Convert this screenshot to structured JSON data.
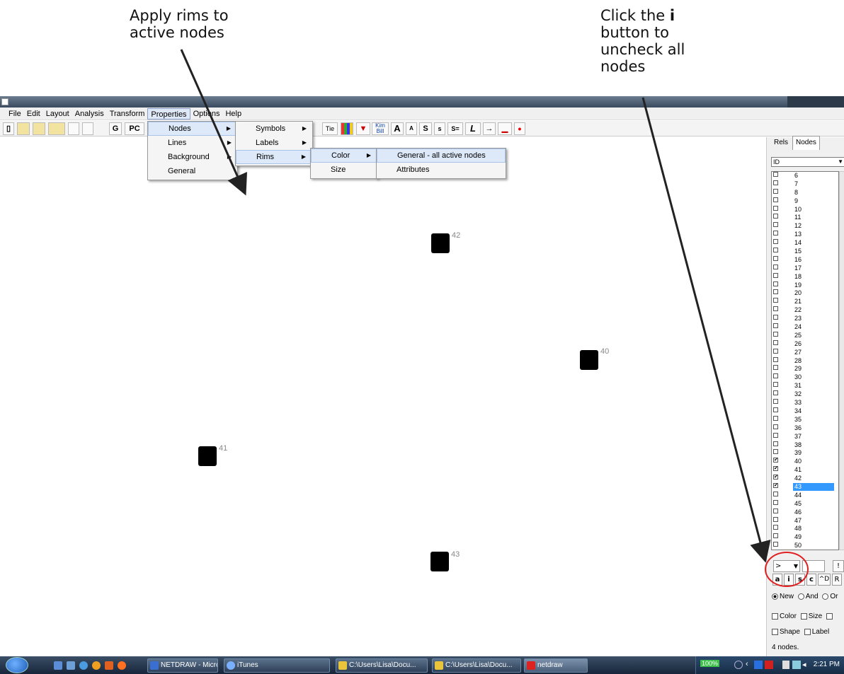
{
  "annotations": {
    "left_line1": "Apply rims to",
    "left_line2": "active nodes",
    "right_line1": "Click the ",
    "right_bold": "i",
    "right_line2": "button to",
    "right_line3": "uncheck all",
    "right_line4": "nodes"
  },
  "menubar": [
    "File",
    "Edit",
    "Layout",
    "Analysis",
    "Transform",
    "Properties",
    "Options",
    "Help"
  ],
  "toolbar": {
    "g": "G",
    "pc": "PC",
    "tie": "Tie",
    "kim_bill": "Kim Bill",
    "a_big": "A",
    "a_small": "A",
    "s_big": "S",
    "s_small": "s",
    "s_eq": "S=",
    "l": "L",
    "arrow": "→",
    "dot": "•"
  },
  "menus": {
    "properties": [
      "Nodes",
      "Lines",
      "Background",
      "General"
    ],
    "nodes_sub": [
      "Symbols",
      "Labels",
      "Rims"
    ],
    "rims_sub": [
      "Color",
      "Size"
    ],
    "color_sub": [
      "General - all active nodes",
      "Attributes"
    ]
  },
  "nodes": [
    {
      "label": "42"
    },
    {
      "label": "40"
    },
    {
      "label": "41"
    },
    {
      "label": "43"
    }
  ],
  "panel": {
    "tab_rels": "Rels",
    "tab_nodes": "Nodes",
    "select_value": "ID",
    "rows": [
      {
        "n": "6",
        "c": false
      },
      {
        "n": "7",
        "c": false
      },
      {
        "n": "8",
        "c": false
      },
      {
        "n": "9",
        "c": false
      },
      {
        "n": "10",
        "c": false
      },
      {
        "n": "11",
        "c": false
      },
      {
        "n": "12",
        "c": false
      },
      {
        "n": "13",
        "c": false
      },
      {
        "n": "14",
        "c": false
      },
      {
        "n": "15",
        "c": false
      },
      {
        "n": "16",
        "c": false
      },
      {
        "n": "17",
        "c": false
      },
      {
        "n": "18",
        "c": false
      },
      {
        "n": "19",
        "c": false
      },
      {
        "n": "20",
        "c": false
      },
      {
        "n": "21",
        "c": false
      },
      {
        "n": "22",
        "c": false
      },
      {
        "n": "23",
        "c": false
      },
      {
        "n": "24",
        "c": false
      },
      {
        "n": "25",
        "c": false
      },
      {
        "n": "26",
        "c": false
      },
      {
        "n": "27",
        "c": false
      },
      {
        "n": "28",
        "c": false
      },
      {
        "n": "29",
        "c": false
      },
      {
        "n": "30",
        "c": false
      },
      {
        "n": "31",
        "c": false
      },
      {
        "n": "32",
        "c": false
      },
      {
        "n": "33",
        "c": false
      },
      {
        "n": "34",
        "c": false
      },
      {
        "n": "35",
        "c": false
      },
      {
        "n": "36",
        "c": false
      },
      {
        "n": "37",
        "c": false
      },
      {
        "n": "38",
        "c": false
      },
      {
        "n": "39",
        "c": false
      },
      {
        "n": "40",
        "c": true
      },
      {
        "n": "41",
        "c": true
      },
      {
        "n": "42",
        "c": true
      },
      {
        "n": "43",
        "c": true,
        "sel": true
      },
      {
        "n": "44",
        "c": false
      },
      {
        "n": "45",
        "c": false
      },
      {
        "n": "46",
        "c": false
      },
      {
        "n": "47",
        "c": false
      },
      {
        "n": "48",
        "c": false
      },
      {
        "n": "49",
        "c": false
      },
      {
        "n": "50",
        "c": false
      }
    ],
    "op_value": ">",
    "btn_bang": "!",
    "btn_a": "a",
    "btn_i": "i",
    "btn_s": "s",
    "btn_c": "c",
    "btn_d": "^D",
    "btn_r": "R",
    "radio_new": "New",
    "radio_and": "And",
    "radio_or": "Or",
    "chk_color": "Color",
    "chk_size": "Size",
    "chk_shape": "Shape",
    "chk_label": "Label",
    "status": "4 nodes."
  },
  "taskbar": {
    "tasks": [
      "NETDRAW - Micros...",
      "iTunes",
      "C:\\Users\\Lisa\\Docu...",
      "C:\\Users\\Lisa\\Docu...",
      "netdraw"
    ],
    "zoom": "100%",
    "clock": "2:21 PM"
  }
}
